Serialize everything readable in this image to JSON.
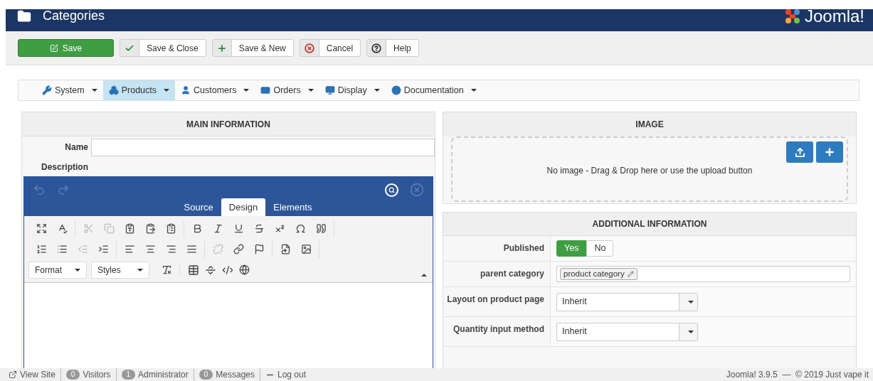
{
  "header": {
    "title": "Categories",
    "logo_text": "Joomla!"
  },
  "toolbar": [
    {
      "kind": "primary",
      "label": "Save"
    },
    {
      "kind": "check",
      "label": "Save & Close"
    },
    {
      "kind": "plus",
      "label": "Save & New"
    },
    {
      "kind": "cancel",
      "label": "Cancel"
    },
    {
      "kind": "help",
      "label": "Help"
    }
  ],
  "menu": [
    {
      "kind": "system",
      "label": "System",
      "selected": false
    },
    {
      "kind": "products",
      "label": "Products",
      "selected": true
    },
    {
      "kind": "customers",
      "label": "Customers",
      "selected": false
    },
    {
      "kind": "orders",
      "label": "Orders",
      "selected": false
    },
    {
      "kind": "display",
      "label": "Display",
      "selected": false
    },
    {
      "kind": "docs",
      "label": "Documentation",
      "selected": false
    }
  ],
  "main": {
    "title": "MAIN INFORMATION",
    "name_label": "Name",
    "description_label": "Description",
    "editor": {
      "history": [
        {
          "disabled": true
        },
        {
          "disabled": true
        }
      ],
      "tabs": [
        {
          "label": "Source",
          "selected": false
        },
        {
          "label": "Design",
          "selected": true
        },
        {
          "label": "Elements",
          "selected": false
        }
      ],
      "tools": [
        [
          {
            "disabled": false
          },
          {
            "disabled": false
          }
        ],
        [
          {
            "disabled": true
          },
          {
            "disabled": true
          },
          {
            "disabled": false
          },
          {
            "disabled": false
          },
          {
            "disabled": false
          }
        ],
        [
          {
            "disabled": false
          },
          {
            "disabled": false
          },
          {
            "disabled": false
          },
          {
            "disabled": false
          },
          {
            "disabled": false
          },
          {
            "disabled": false
          },
          {
            "disabled": false
          }
        ],
        [
          {
            "disabled": false
          },
          {
            "disabled": false
          },
          {
            "disabled": true
          },
          {
            "disabled": false
          }
        ],
        [
          {
            "disabled": false
          },
          {
            "disabled": false
          },
          {
            "disabled": false
          },
          {
            "disabled": false
          }
        ],
        [
          {
            "disabled": true
          },
          {
            "disabled": false
          },
          {
            "disabled": false
          }
        ],
        [
          {
            "disabled": false
          },
          {
            "disabled": false
          }
        ]
      ],
      "dropdowns": [
        "Format",
        "Styles"
      ]
    }
  },
  "image": {
    "title": "IMAGE",
    "hint": "No image - Drag & Drop here or use the upload button"
  },
  "additional": {
    "title": "ADDITIONAL INFORMATION",
    "fields": [
      {
        "kind": "toggle",
        "label": "Published",
        "options": [
          {
            "label": "Yes",
            "selected": true
          },
          {
            "label": "No",
            "selected": false
          }
        ]
      },
      {
        "kind": "tag",
        "label": "parent category",
        "value": "product category"
      },
      {
        "kind": "select",
        "label": "Layout on product page",
        "value": "Inherit"
      },
      {
        "kind": "select",
        "label": "Quantity input method",
        "value": "Inherit"
      }
    ]
  },
  "status_bar": {
    "items": [
      {
        "kind": "link",
        "label": "View Site"
      },
      {
        "kind": "count",
        "count": "0",
        "label": "Visitors"
      },
      {
        "kind": "count",
        "count": "1",
        "label": "Administrator"
      },
      {
        "kind": "count",
        "count": "0",
        "label": "Messages"
      },
      {
        "kind": "logout",
        "label": "Log out"
      }
    ],
    "copyright": "Joomla! 3.9.5  —  © 2019 Just vape it"
  }
}
